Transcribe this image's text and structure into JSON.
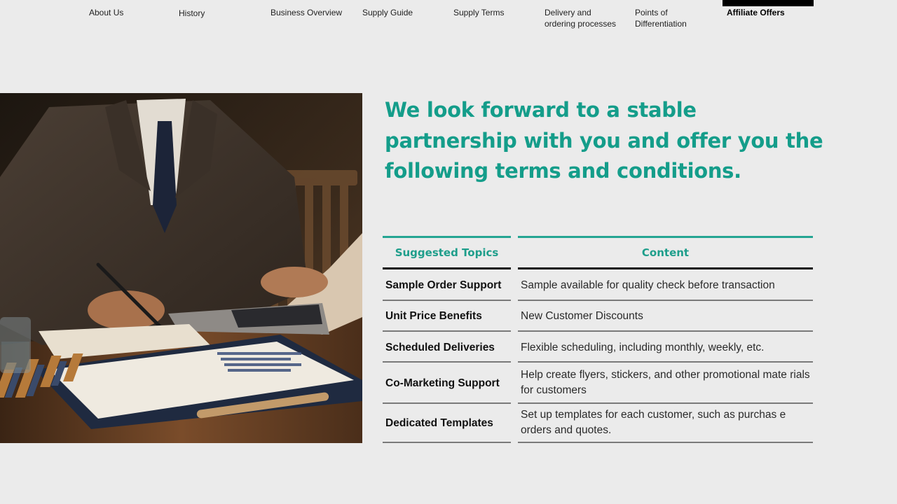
{
  "nav": {
    "items": [
      {
        "label": "About Us"
      },
      {
        "label": "History"
      },
      {
        "label": "Business Overview"
      },
      {
        "label": "Supply Guide"
      },
      {
        "label": "Supply Terms"
      },
      {
        "label": "Delivery and\nordering processes"
      },
      {
        "label": "Points of\nDifferentiation"
      },
      {
        "label": "Affiliate Offers",
        "active": true
      }
    ]
  },
  "hero": {
    "headline": "We look forward to a stable partnership with you and offer you the following terms and conditions.",
    "image_alt": "businessman-working-at-laptop-photo"
  },
  "table": {
    "headers": [
      "Suggested Topics",
      "Content"
    ],
    "rows": [
      {
        "topic": "Sample Order Support",
        "content": "Sample available for quality check before transaction"
      },
      {
        "topic": "Unit Price Benefits",
        "content": "New Customer Discounts"
      },
      {
        "topic": "Scheduled Deliveries",
        "content": "Flexible scheduling, including monthly, weekly, etc."
      },
      {
        "topic": "Co-Marketing Support",
        "content": "Help create flyers, stickers, and other promotional mate rials for customers"
      },
      {
        "topic": "Dedicated Templates",
        "content": "Set up templates for each customer, such as purchas e orders and quotes."
      }
    ]
  },
  "colors": {
    "accent": "#149d8a",
    "background": "#ebebeb",
    "active_bar": "#000000"
  }
}
